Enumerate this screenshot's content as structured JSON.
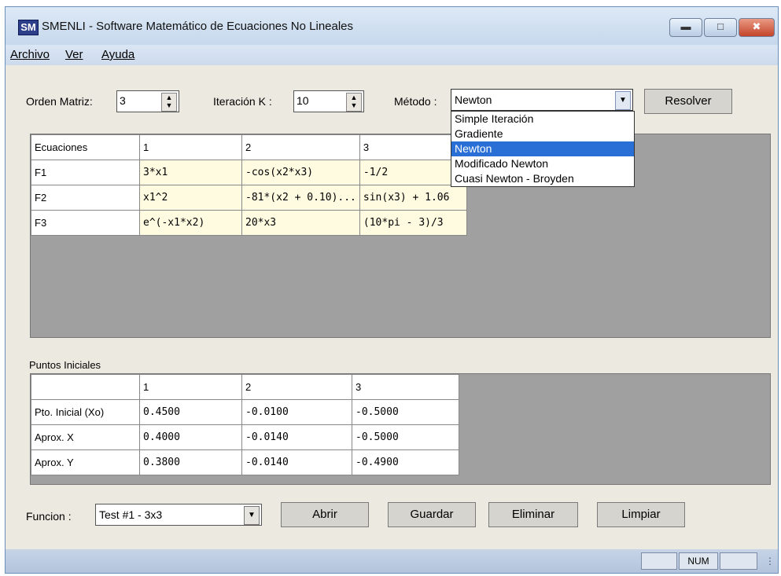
{
  "window": {
    "title": "SMENLI - Software Matemático de Ecuaciones No Lineales",
    "icon": "SM"
  },
  "menu": [
    "Archivo",
    "Ver",
    "Ayuda"
  ],
  "controls": {
    "orden_label": "Orden Matriz:",
    "orden_value": "3",
    "iter_label": "Iteración K :",
    "iter_value": "10",
    "metodo_label": "Método :",
    "metodo_value": "Newton",
    "resolver": "Resolver"
  },
  "metodo_options": [
    "Simple Iteración",
    "Gradiente",
    "Newton",
    "Modificado Newton",
    "Cuasi Newton - Broyden"
  ],
  "equations": {
    "headers": [
      "Ecuaciones",
      "1",
      "2",
      "3"
    ],
    "rows": [
      [
        "F1",
        "3*x1",
        "-cos(x2*x3)",
        "-1/2"
      ],
      [
        "F2",
        "x1^2",
        "-81*(x2 + 0.10)...",
        "sin(x3) + 1.06"
      ],
      [
        "F3",
        "e^(-x1*x2)",
        "20*x3",
        "(10*pi - 3)/3"
      ]
    ]
  },
  "puntos": {
    "label": "Puntos Iniciales",
    "headers": [
      "",
      "1",
      "2",
      "3"
    ],
    "rows": [
      [
        "Pto. Inicial (Xo)",
        "0.4500",
        "-0.0100",
        "-0.5000"
      ],
      [
        "Aprox. X",
        "0.4000",
        "-0.0140",
        "-0.5000"
      ],
      [
        "Aprox. Y",
        "0.3800",
        "-0.0140",
        "-0.4900"
      ]
    ]
  },
  "bottom": {
    "funcion_label": "Funcion :",
    "funcion_value": "Test #1 - 3x3",
    "abrir": "Abrir",
    "guardar": "Guardar",
    "eliminar": "Eliminar",
    "limpiar": "Limpiar"
  },
  "status": {
    "num": "NUM"
  }
}
